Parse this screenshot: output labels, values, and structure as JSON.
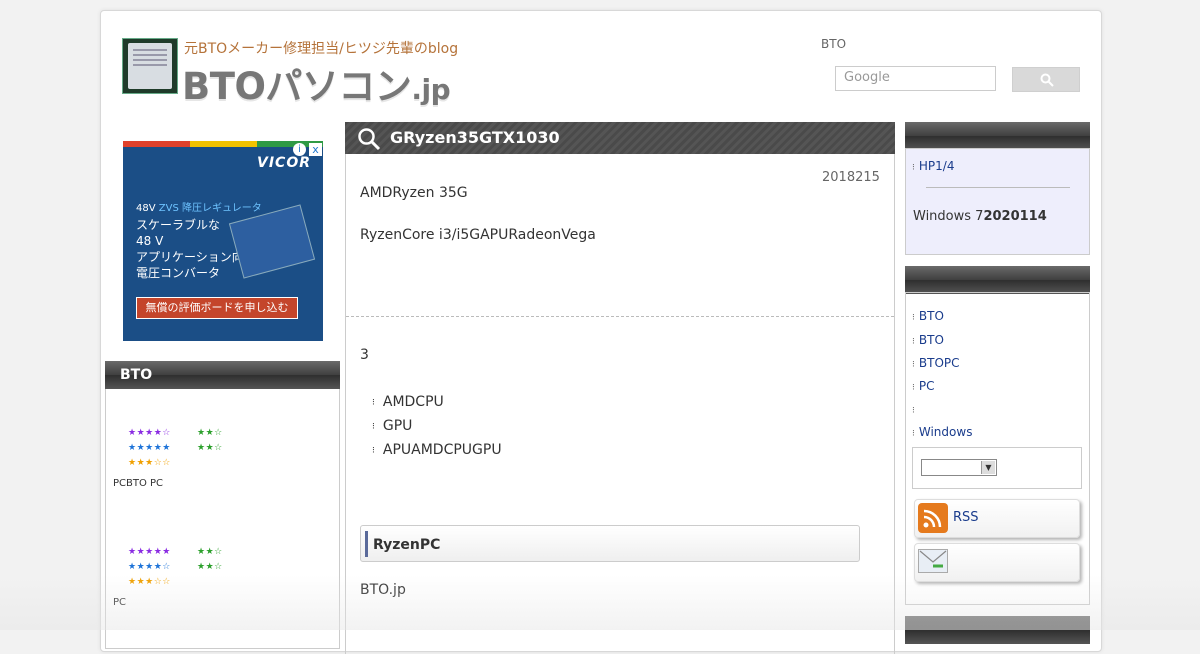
{
  "header": {
    "tagline": "元BTOメーカー修理担当/ヒツジ先輩のblog",
    "logo_main": "BTOパソコン",
    "logo_suffix": ".jp",
    "label": "BTO",
    "search_placeholder": "Google"
  },
  "ad": {
    "brand": "VICOR",
    "line1_prefix": "48V",
    "line1_highlight": "ZVS 降圧レギュレータ",
    "line2": "スケーラブルな",
    "line3": "48 V",
    "line4": "アプリケーション向け",
    "line5": "電圧コンバータ",
    "cta": "無償の評価ボードを申し込む",
    "info_icon": "i",
    "close_icon": "x"
  },
  "left_sidebar": {
    "bar_title": "BTO",
    "ratings": [
      {
        "rows": [
          "★★★★☆",
          "★★★★★",
          "★★★☆☆"
        ],
        "right_rows": [
          "★★☆",
          "★★☆"
        ],
        "label": "PCBTO PC"
      },
      {
        "rows": [
          "★★★★★",
          "★★★★☆",
          "★★★☆☆"
        ],
        "right_rows": [
          "★★☆",
          "★★☆"
        ],
        "label": "PC"
      }
    ],
    "star_colors": [
      "#8a2be2",
      "#1e73d8",
      "#f0a000",
      "#2ca02c"
    ]
  },
  "article": {
    "title": "GRyzen35GTX1030",
    "date": "2018215",
    "p1": "AMDRyzen 35G",
    "p2": "RyzenCore i3/i5GAPURadeonVega",
    "p3": "3",
    "bullets": [
      "AMDCPU",
      "GPU",
      "APUAMDCPUGPU"
    ],
    "subheading": "RyzenPC",
    "p4": "BTO.jp"
  },
  "right_sidebar": {
    "panel1_link": "HP1/4",
    "panel1_text_prefix": "Windows 7",
    "panel1_text_bold": "2020114",
    "links": [
      "BTO",
      "BTO",
      "BTOPC",
      "PC",
      "",
      "Windows"
    ],
    "rss_label": "RSS",
    "mail_label": ""
  }
}
